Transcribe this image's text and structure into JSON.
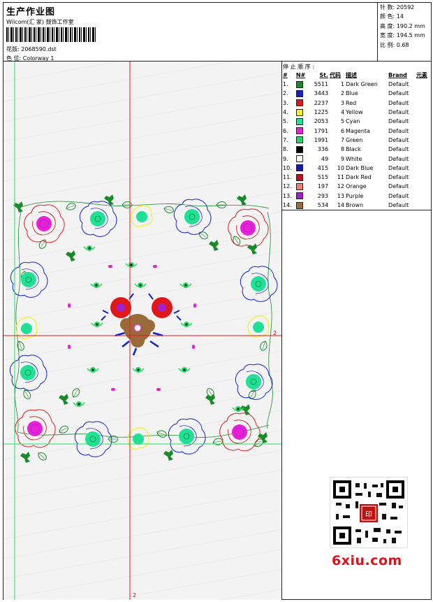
{
  "header": {
    "title": "生产作业图",
    "subtitle": "Wilcom(汇 家) 鼓饰工作室",
    "design_label": "花版:",
    "design_value": "2068590.dst",
    "colorway_label": "色 位:",
    "colorway_value": "Colorway 1"
  },
  "stats": {
    "stitches_label": "针 数:",
    "stitches": "20592",
    "colors_label": "颜 色:",
    "colors": "14",
    "height_label": "高 度:",
    "height": "190.2 mm",
    "width_label": "宽 度:",
    "width": "194.5 mm",
    "scale_label": "比 例:",
    "scale": "0.68"
  },
  "legend": {
    "stop_label": "停 止 顺 序 :",
    "columns": [
      "#",
      "N#",
      "St.",
      "代码",
      "描述",
      "Brand",
      "元素"
    ],
    "rows": [
      {
        "n": "1.",
        "code": "1",
        "st": "5511",
        "c": "1",
        "desc": "Dark Green",
        "brand": "Default",
        "color": "#1a8a2a"
      },
      {
        "n": "2.",
        "code": "2",
        "st": "3443",
        "c": "2",
        "desc": "Blue",
        "brand": "Default",
        "color": "#1020d0"
      },
      {
        "n": "3.",
        "code": "3",
        "st": "2237",
        "c": "3",
        "desc": "Red",
        "brand": "Default",
        "color": "#e01818"
      },
      {
        "n": "4.",
        "code": "4",
        "st": "1225",
        "c": "4",
        "desc": "Yellow",
        "brand": "Default",
        "color": "#f2f020"
      },
      {
        "n": "5.",
        "code": "5",
        "st": "2053",
        "c": "5",
        "desc": "Cyan",
        "brand": "Default",
        "color": "#20e098"
      },
      {
        "n": "6.",
        "code": "6",
        "st": "1791",
        "c": "6",
        "desc": "Magenta",
        "brand": "Default",
        "color": "#e820d8"
      },
      {
        "n": "7.",
        "code": "7",
        "st": "1991",
        "c": "7",
        "desc": "Green",
        "brand": "Default",
        "color": "#20d860"
      },
      {
        "n": "8.",
        "code": "8",
        "st": "336",
        "c": "8",
        "desc": "Black",
        "brand": "Default",
        "color": "#000000"
      },
      {
        "n": "9.",
        "code": "9",
        "st": "49",
        "c": "9",
        "desc": "White",
        "brand": "Default",
        "color": "#ffffff"
      },
      {
        "n": "10.",
        "code": "10",
        "st": "415",
        "c": "10",
        "desc": "Dark Blue",
        "brand": "Default",
        "color": "#1018c0"
      },
      {
        "n": "11.",
        "code": "11",
        "st": "515",
        "c": "11",
        "desc": "Dark Red",
        "brand": "Default",
        "color": "#c01010"
      },
      {
        "n": "12.",
        "code": "12",
        "st": "197",
        "c": "12",
        "desc": "Orange",
        "brand": "Default",
        "color": "#f08070"
      },
      {
        "n": "13.",
        "code": "13",
        "st": "293",
        "c": "13",
        "desc": "Purple",
        "brand": "Default",
        "color": "#a020d0"
      },
      {
        "n": "14.",
        "code": "14",
        "st": "534",
        "c": "14",
        "desc": "Brown",
        "brand": "Default",
        "color": "#9a6a3a"
      }
    ]
  },
  "canvas": {
    "guide_label_right": "2",
    "guide_label_bottom": "2"
  },
  "watermark": {
    "site": "6xiu.com",
    "stamp": "印"
  }
}
